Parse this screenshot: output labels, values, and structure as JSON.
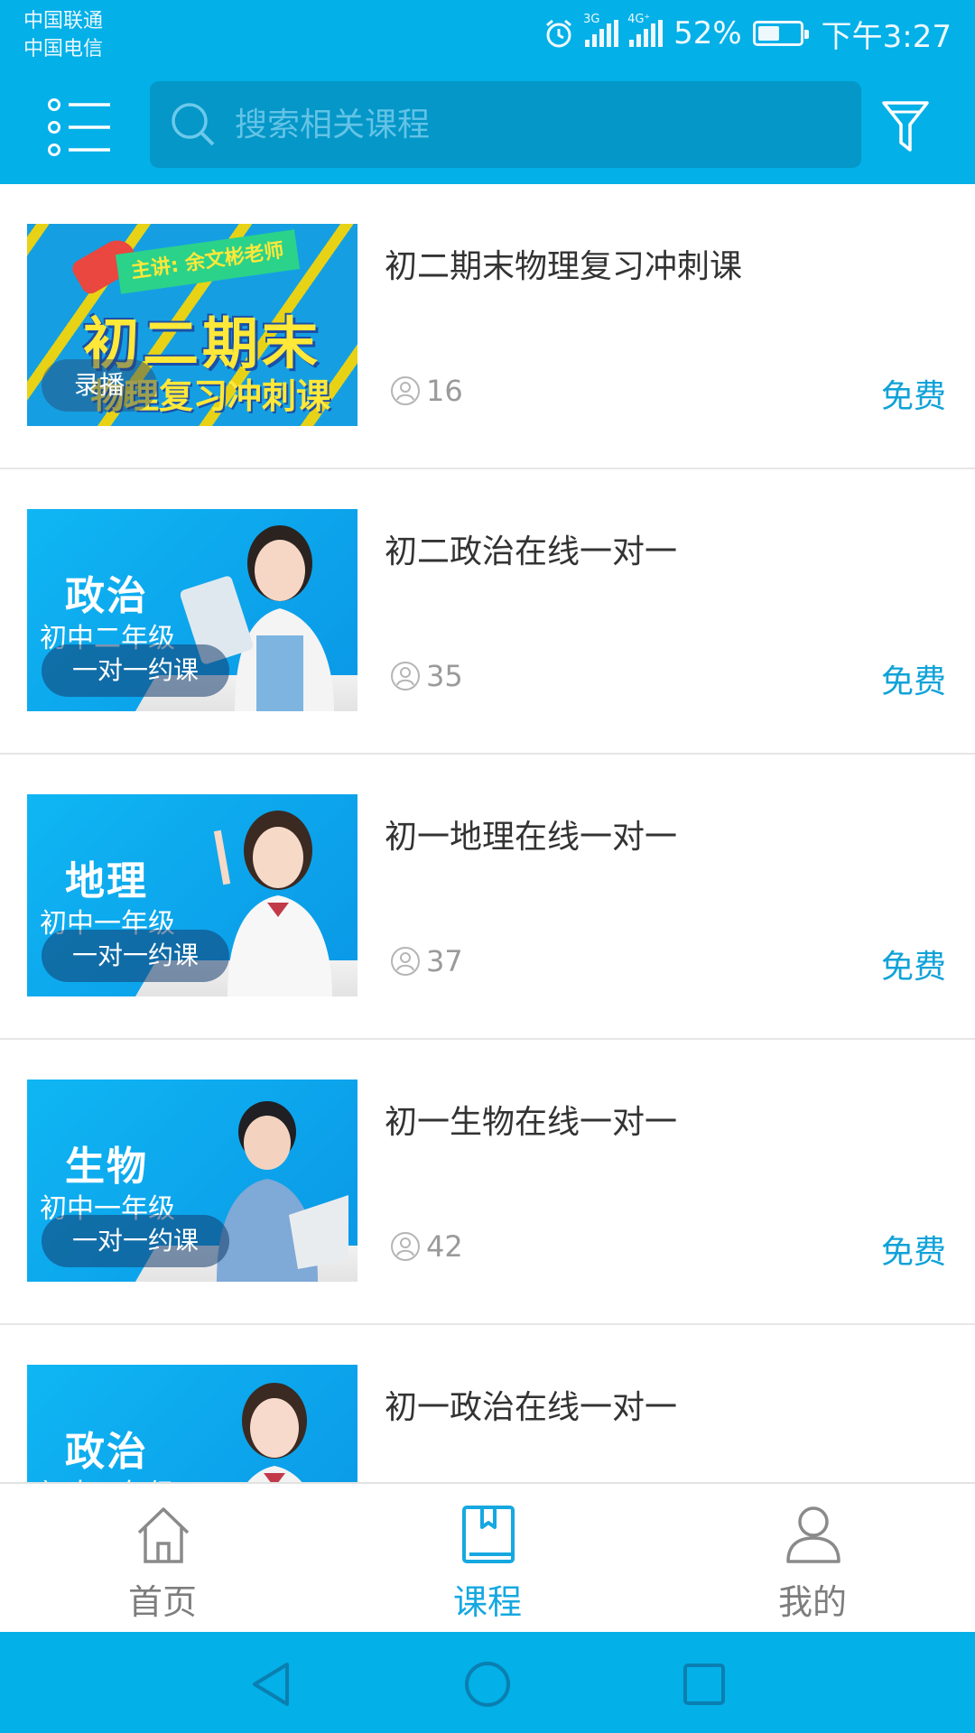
{
  "status_bar": {
    "carrier_1": "中国联通",
    "carrier_2": "中国电信",
    "signal_1_tag": "3G",
    "signal_2_tag": "4G⁺",
    "battery_percent": "52%",
    "battery_level": 0.52,
    "time": "下午3:27"
  },
  "header": {
    "search_placeholder": "搜索相关课程",
    "icons": [
      "list-menu-icon",
      "search-icon",
      "filter-icon"
    ]
  },
  "courses": [
    {
      "title": "初二期末物理复习冲刺课",
      "students": "16",
      "price": "免费",
      "badge": "录播",
      "thumb_type": "promo",
      "thumb_ribbon": "主讲: 余文彬老师",
      "thumb_main": "初二期末",
      "thumb_sub": "物理复习冲刺课"
    },
    {
      "title": "初二政治在线一对一",
      "students": "35",
      "price": "免费",
      "badge": "一对一约课",
      "thumb_type": "tutor",
      "thumb_subject": "政治",
      "thumb_grade": "初中二年级"
    },
    {
      "title": "初一地理在线一对一",
      "students": "37",
      "price": "免费",
      "badge": "一对一约课",
      "thumb_type": "tutor",
      "thumb_subject": "地理",
      "thumb_grade": "初中一年级"
    },
    {
      "title": "初一生物在线一对一",
      "students": "42",
      "price": "免费",
      "badge": "一对一约课",
      "thumb_type": "tutor",
      "thumb_subject": "生物",
      "thumb_grade": "初中一年级"
    },
    {
      "title": "初一政治在线一对一",
      "thumb_type": "tutor",
      "thumb_subject": "政治",
      "thumb_grade": "初中一年级"
    }
  ],
  "bottom_nav": {
    "items": [
      {
        "label": "首页",
        "icon": "home-icon",
        "active": false
      },
      {
        "label": "课程",
        "icon": "book-icon",
        "active": true
      },
      {
        "label": "我的",
        "icon": "person-icon",
        "active": false
      }
    ]
  },
  "colors": {
    "brand": "#03b0e8",
    "accent_text": "#10a2d8",
    "search_bg": "#0497c8"
  }
}
